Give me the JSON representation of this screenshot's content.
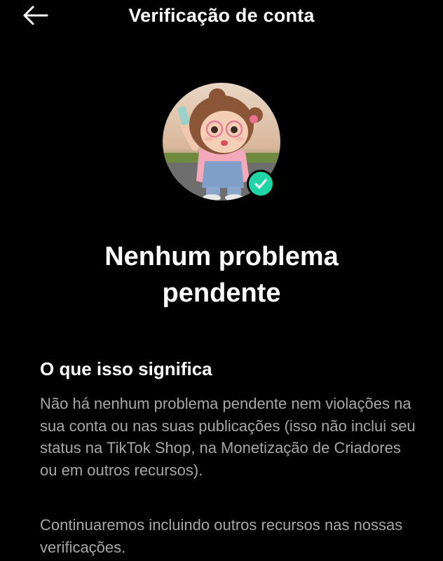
{
  "header": {
    "title": "Verificação de conta",
    "back_icon": "arrow-left-icon"
  },
  "profile": {
    "badge_icon": "check-circle-icon",
    "badge_color": "#20d5a5"
  },
  "status": {
    "title": "Nenhum problema pendente"
  },
  "info": {
    "heading": "O que isso significa",
    "paragraph1": "Não há nenhum problema pendente nem violações na sua conta ou nas suas publicações (isso não inclui seu status na TikTok Shop, na Monetização de Criadores ou em outros recursos).",
    "paragraph2": "Continuaremos incluindo outros recursos nas nossas verificações."
  }
}
